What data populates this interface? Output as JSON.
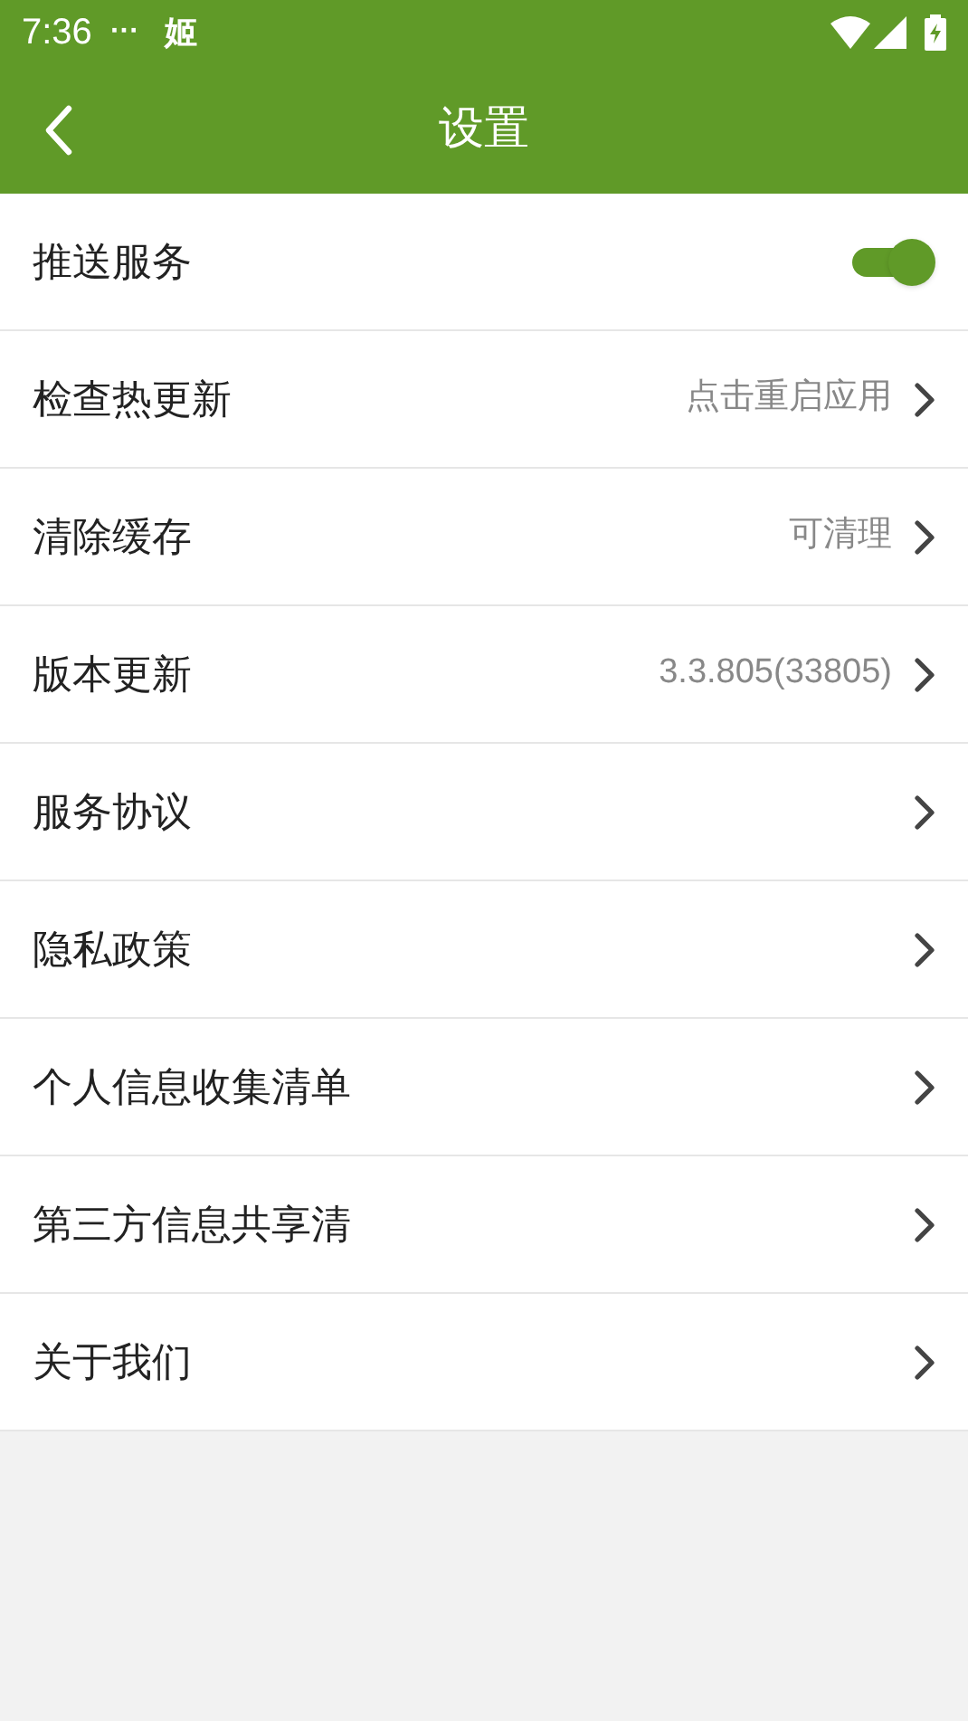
{
  "status_bar": {
    "time": "7:36",
    "dots": "···",
    "app_glyph": "姬"
  },
  "header": {
    "title": "设置"
  },
  "items": [
    {
      "kind": "switch",
      "label": "推送服务",
      "on": true
    },
    {
      "kind": "link",
      "label": "检查热更新",
      "value": "点击重启应用"
    },
    {
      "kind": "link",
      "label": "清除缓存",
      "value": "可清理"
    },
    {
      "kind": "link",
      "label": "版本更新",
      "value": "3.3.805(33805)"
    },
    {
      "kind": "link",
      "label": "服务协议"
    },
    {
      "kind": "link",
      "label": "隐私政策"
    },
    {
      "kind": "link",
      "label": "个人信息收集清单"
    },
    {
      "kind": "link",
      "label": "第三方信息共享清"
    },
    {
      "kind": "link",
      "label": "关于我们"
    }
  ]
}
